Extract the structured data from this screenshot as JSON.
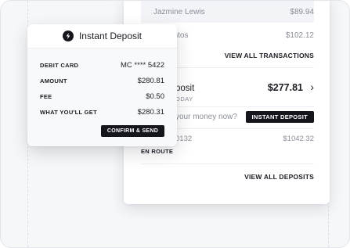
{
  "transactions": {
    "items": [
      {
        "name": "Jazmine Lewis",
        "amount": "$89.94"
      },
      {
        "name": "ny Santos",
        "amount": "$102.12"
      }
    ],
    "view_all_label": "VIEW ALL TRANSACTIONS"
  },
  "deposit": {
    "title": "posit",
    "subtitle": "ODAY",
    "amount": "$277.81",
    "question": "your money now?",
    "instant_button": "INSTANT DEPOSIT",
    "account_number": "0132",
    "account_balance": "$1042.32",
    "status": "EN ROUTE",
    "view_all_label": "VIEW ALL DEPOSITS"
  },
  "modal": {
    "title": "Instant Deposit",
    "icon": "bolt-icon",
    "rows": [
      {
        "label": "DEBIT CARD",
        "value": "MC **** 5422"
      },
      {
        "label": "AMOUNT",
        "value": "$280.81"
      },
      {
        "label": "FEE",
        "value": "$0.50"
      },
      {
        "label": "WHAT YOU'LL GET",
        "value": "$280.31"
      }
    ],
    "confirm_label": "CONFIRM & SEND"
  },
  "colors": {
    "accent_dark": "#15151c",
    "muted_text": "#8b8e99",
    "background": "#f6f7f9"
  }
}
